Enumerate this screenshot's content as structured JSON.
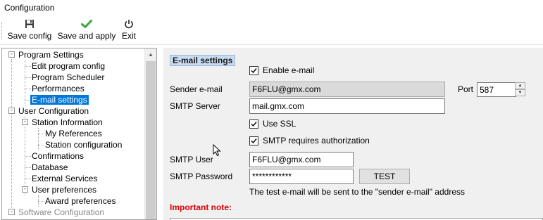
{
  "window": {
    "title": "Configuration"
  },
  "toolbar": {
    "save_config": {
      "label": "Save config",
      "icon": "floppy-disk-icon"
    },
    "save_apply": {
      "label": "Save and apply",
      "icon": "green-checkmark-icon"
    },
    "exit": {
      "label": "Exit",
      "icon": "power-icon"
    }
  },
  "tree": {
    "program_settings": "Program Settings",
    "edit_program_config": "Edit program config",
    "program_scheduler": "Program Scheduler",
    "performances": "Performances",
    "email_settings": "E-mail settings",
    "user_configuration": "User Configuration",
    "station_information": "Station Information",
    "my_references": "My References",
    "station_configuration": "Station configuration",
    "confirmations": "Confirmations",
    "database": "Database",
    "external_services": "External Services",
    "user_preferences": "User preferences",
    "award_preferences": "Award preferences",
    "software_configuration": "Software Configuration",
    "expanded_symbol": "-",
    "scroll_up_symbol": "▲"
  },
  "email": {
    "section_title": "E-mail settings",
    "enable_label": "Enable e-mail",
    "enable_checked": true,
    "sender_label": "Sender e-mail",
    "sender_value": "F6FLU@gmx.com",
    "port_label": "Port",
    "port_value": "587",
    "smtp_server_label": "SMTP Server",
    "smtp_server_value": "mail.gmx.com",
    "use_ssl_label": "Use SSL",
    "use_ssl_checked": true,
    "smtp_auth_label": "SMTP requires authorization",
    "smtp_auth_checked": true,
    "smtp_user_label": "SMTP User",
    "smtp_user_value": "F6FLU@gmx.com",
    "smtp_password_label": "SMTP Password",
    "smtp_password_value": "************",
    "test_button": "TEST",
    "test_info": "The test e-mail will be sent to the \"sender e-mail\" address",
    "important_note": "Important note:"
  },
  "colors": {
    "selection": "#0078d7",
    "important": "#e00000",
    "panel_bg": "#f0f0f0",
    "checkmark_green": "#3aa83a"
  }
}
